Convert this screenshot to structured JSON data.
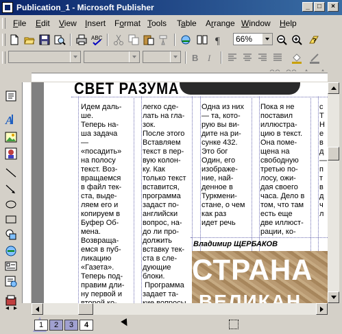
{
  "window": {
    "title": "Publication_1 - Microsoft Publisher"
  },
  "menu": [
    "File",
    "Edit",
    "View",
    "Insert",
    "Format",
    "Tools",
    "Table",
    "Arrange",
    "Window",
    "Help"
  ],
  "menu_underline": [
    "F",
    "E",
    "V",
    "I",
    "o",
    "T",
    "a",
    "r",
    "W",
    "H"
  ],
  "standard_toolbar": {
    "zoom_value": "66%"
  },
  "formatting_toolbar": {
    "style_value": "",
    "font_value": "",
    "size_value": ""
  },
  "document": {
    "masthead": "СВЕТ РАЗУМА",
    "columns": [
      "Идем даль-\nше.\nТеперь на-\nша задача\n—\n«посадить»\nна полосу\nтекст. Воз-\nвращаемся\nв файл тек-\nста, выде-\nляем его и\nкопируем в\nБуфер Об-\nмена.\nВозвраща-\nемся в пуб-\nликацию\n«Газета».\nТеперь под-\nправим дли-\nну первой и\nвторой ко-",
      "легко сде-\nлать на гла-\nзок.\nПосле этого\nВставляем\nтекст в пер-\nвую колон-\nку. Как\nтолько текст\nвставится,\nпрограмма\nзадаст по-\nанглийски\nвопрос, на-\nдо ли про-\nдолжить\nвставку тек-\nста в сле-\nдующие\nблоки.\n Программа\nзадает та-\nкие вопросы",
      "Одна из них\n— та, кото-\nрую вы ви-\nдите на ри-\nсунке 432.\nЭто бог\nОдин, его\nизображе-\nние, най-\nденное в\nТуркмени-\nстане, о чем\nкак раз\nидет речь\nв врезке.",
      "Пока я не\nпоставил\nиллюстра-\nцию в текст.\nОна поме-\nщена на\nсвободную\nтретью по-\nлосу, ожи-\nдая своего\nчаса. Дело в\nтом, что там\nесть еще\nдве иллюст-\nрации, ко-",
      "с\nТ\nН\nе\nв\nд\n—\nп\nт\nв\nд\nч\nл"
    ],
    "byline": "Владимир ЩЕРБАКОВ",
    "headline": "СТРАНА",
    "headline2": "ВЕЛИКАН"
  },
  "pages": [
    "1",
    "2",
    "3",
    "4"
  ],
  "active_page": "4",
  "icons": {
    "standard": [
      "new-icon",
      "open-icon",
      "save-icon",
      "search-icon",
      "print-icon",
      "print-preview-icon",
      "spelling-icon",
      "cut-icon",
      "copy-icon",
      "paste-icon",
      "format-painter-icon",
      "undo-icon",
      "redo-icon",
      "insert-hyperlink-icon",
      "columns-icon",
      "show-special-characters-icon",
      "zoom-out-icon",
      "zoom-in-icon",
      "help-icon"
    ],
    "objects": [
      "text-box-icon",
      "word-art-icon",
      "picture-frame-icon",
      "clip-art-icon",
      "line-icon",
      "arrow-icon",
      "oval-icon",
      "rectangle-icon",
      "autoshapes-icon",
      "hot-spot-icon",
      "form-control-icon",
      "html-code-icon",
      "design-gallery-icon"
    ]
  },
  "colors": {
    "title_start": "#0a246a",
    "title_end": "#3a6ea5",
    "guide": "#6a6ab0",
    "chrome": "#d4d0c8"
  }
}
